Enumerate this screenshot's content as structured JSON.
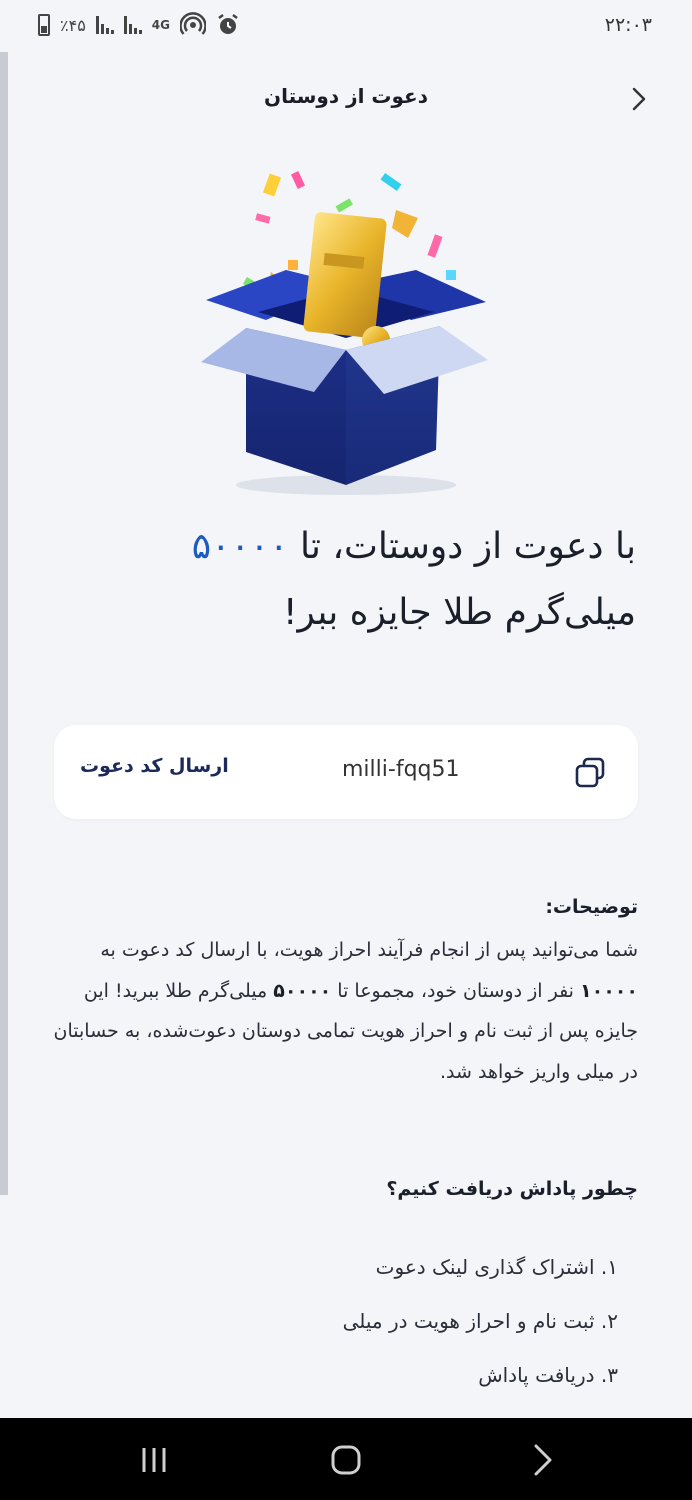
{
  "status_bar": {
    "time": "۲۲:۰۳",
    "battery_percent": "٪۴۵",
    "network": "4G"
  },
  "header": {
    "title": "دعوت از دوستان",
    "back_icon": "chevron-right-icon"
  },
  "hero": {
    "image": "gift-box-with-gold-bar-illustration"
  },
  "headline": {
    "prefix": "با دعوت از دوستات، تا",
    "amount": "۵۰۰۰۰",
    "suffix": "میلی‌گرم طلا جایزه ببر!"
  },
  "invite": {
    "send_label": "ارسال کد دعوت",
    "code": "milli-fqq51",
    "copy_icon": "copy-icon"
  },
  "description": {
    "title": "توضیحات:",
    "part1": "شما می‌توانید پس از انجام فرآیند احراز هویت، با ارسال کد دعوت به ",
    "count": "۱۰۰۰۰",
    "part2": " نفر از دوستان خود، مجموعا تا ",
    "amount": "۵۰۰۰۰",
    "part3": " میلی‌گرم طلا ببرید! این جایزه پس از ثبت نام و احراز هویت تمامی دوستان دعوت‌شده، به حسابتان در میلی واریز خواهد شد."
  },
  "how_to": {
    "title": "چطور پاداش دریافت کنیم؟",
    "steps": [
      "۱. اشتراک گذاری لینک دعوت",
      "۲. ثبت نام و احراز هویت در میلی",
      "۳. دریافت پاداش"
    ]
  },
  "nav_bar": {
    "recent_icon": "recent-apps-icon",
    "home_icon": "home-icon",
    "back_icon": "back-icon"
  },
  "colors": {
    "accent": "#1e5bbf",
    "background": "#f3f5f9",
    "card": "#ffffff"
  }
}
